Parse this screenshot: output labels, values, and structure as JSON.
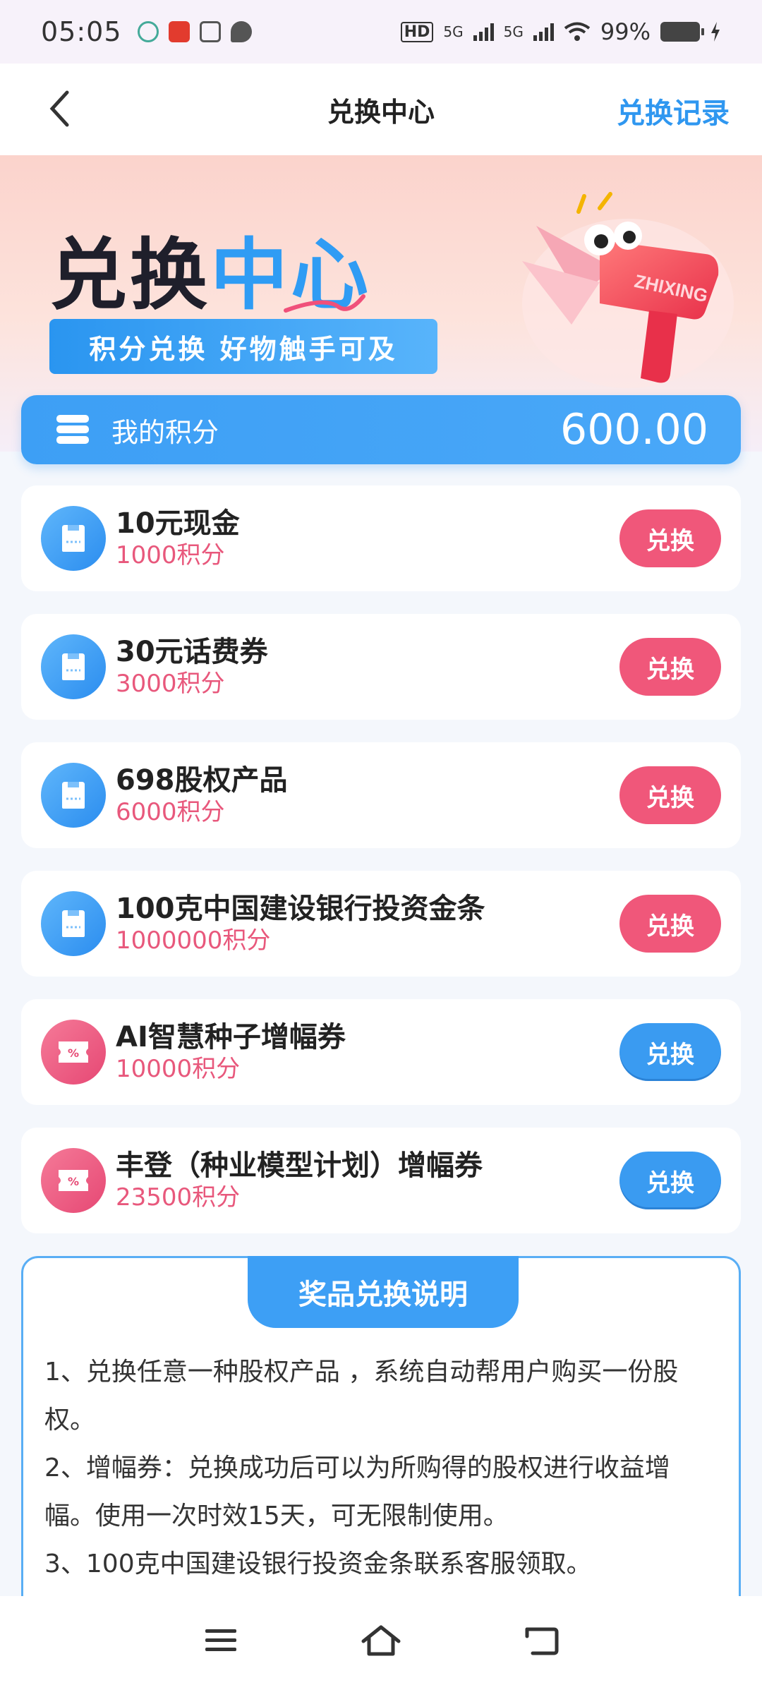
{
  "status_bar": {
    "time": "05:05",
    "hd": "HD",
    "net1": "5G",
    "net2": "5G",
    "battery": "99%"
  },
  "nav": {
    "title": "兑换中心",
    "right_link": "兑换记录"
  },
  "banner": {
    "title_part1": "兑换",
    "title_part2": "中心",
    "subtitle": "积分兑换 好物触手可及",
    "gun_text": "ZHIXING"
  },
  "points": {
    "label": "我的积分",
    "value": "600.00"
  },
  "items": [
    {
      "name": "10元现金",
      "points": "1000积分",
      "button": "兑换",
      "icon": "wallet-icon",
      "style": "pink"
    },
    {
      "name": "30元话费券",
      "points": "3000积分",
      "button": "兑换",
      "icon": "wallet-icon",
      "style": "pink"
    },
    {
      "name": "698股权产品",
      "points": "6000积分",
      "button": "兑换",
      "icon": "wallet-icon",
      "style": "pink"
    },
    {
      "name": "100克中国建设银行投资金条",
      "points": "1000000积分",
      "button": "兑换",
      "icon": "wallet-icon",
      "style": "pink"
    },
    {
      "name": "AI智慧种子增幅券",
      "points": "10000积分",
      "button": "兑换",
      "icon": "coupon-icon",
      "style": "blue"
    },
    {
      "name": "丰登（种业模型计划）增幅券",
      "points": "23500积分",
      "button": "兑换",
      "icon": "coupon-icon",
      "style": "blue"
    }
  ],
  "notes": {
    "title": "奖品兑换说明",
    "line1": "1、兑换任意一种股权产品 ，系统自动帮用户购买一份股权。",
    "line2": "2、增幅券：兑换成功后可以为所购得的股权进行收益增幅。使用一次时效15天，可无限制使用。",
    "line3": "3、100克中国建设银行投资金条联系客服领取。"
  },
  "colors": {
    "accent_blue": "#3d9ff5",
    "accent_pink": "#f0577a",
    "points_pink": "#e8587c"
  }
}
